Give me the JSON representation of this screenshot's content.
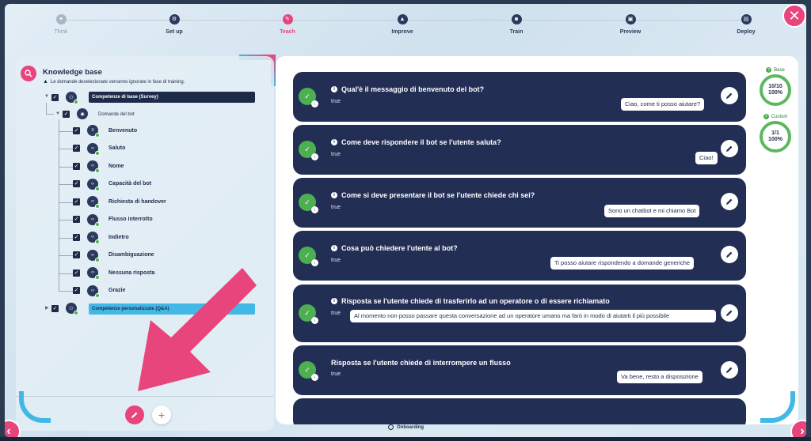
{
  "stepper": {
    "steps": [
      {
        "label": "Think",
        "state": "muted",
        "icon": "lightbulb-icon"
      },
      {
        "label": "Set up",
        "state": "done",
        "icon": "gear-icon"
      },
      {
        "label": "Teach",
        "state": "active",
        "icon": "pencil-icon"
      },
      {
        "label": "Improve",
        "state": "done",
        "icon": "chart-icon"
      },
      {
        "label": "Train",
        "state": "done",
        "icon": "robot-icon"
      },
      {
        "label": "Preview",
        "state": "done",
        "icon": "monitor-icon"
      },
      {
        "label": "Deploy",
        "state": "done",
        "icon": "rocket-icon"
      }
    ]
  },
  "knowledge": {
    "title": "Knowledge base",
    "warning": "Le domande deselezionate verranno ignorate in fase di training.",
    "group_base": "Competenze di base (Survey)",
    "sub_group": "Domande del bot",
    "items": [
      {
        "label": "Benvenuto",
        "icon": "text-icon"
      },
      {
        "label": "Saluto",
        "icon": "code-icon"
      },
      {
        "label": "Nome",
        "icon": "code-icon"
      },
      {
        "label": "Capacità del bot",
        "icon": "code-icon"
      },
      {
        "label": "Richiesta di handover",
        "icon": "code-icon"
      },
      {
        "label": "Flusso interrotto",
        "icon": "code-icon"
      },
      {
        "label": "Indietro",
        "icon": "code-icon"
      },
      {
        "label": "Disambiguazione",
        "icon": "code-icon"
      },
      {
        "label": "Nessuna risposta",
        "icon": "code-icon"
      },
      {
        "label": "Grazie",
        "icon": "code-icon"
      }
    ],
    "group_custom": "Competenze personalizzate (Q&A)"
  },
  "qa": [
    {
      "question": "Qual'è il messaggio di benvenuto del bot?",
      "value": "true",
      "answer": "Ciao, come ti posso aiutare?",
      "info": true
    },
    {
      "question": "Come deve rispondere il bot se l'utente saluta?",
      "value": "true",
      "answer": "Ciao!",
      "info": true
    },
    {
      "question": "Come si deve presentare il bot se l'utente chiede chi sei?",
      "value": "true",
      "answer": "Sono un chatbot e mi chiamo Bot",
      "info": true
    },
    {
      "question": "Cosa può chiedere l'utente al bot?",
      "value": "true",
      "answer": "Ti posso aiutare rispondendo a domande generiche",
      "info": true
    },
    {
      "question": "Risposta se l'utente chiede di trasferirlo ad un operatore o di essere richiamato",
      "value": "true",
      "answer": "Al momento non posso passare questa conversazione ad un operatore umano ma farò in modo di aiutarti il più possibile",
      "info": true
    },
    {
      "question": "Risposta se l'utente chiede di interrompere un flusso",
      "value": "true",
      "answer": "Va bene, resto a disposizione",
      "info": false
    }
  ],
  "stats": {
    "base": {
      "label": "Base",
      "count": "10/10",
      "percent": "100%"
    },
    "custom": {
      "label": "Custom",
      "count": "1/1",
      "percent": "100%"
    }
  },
  "footer": {
    "onboarding": "Onboarding"
  },
  "colors": {
    "accent": "#e8457d",
    "navy": "#232e55",
    "success": "#4caf50",
    "cyan": "#42b8e6"
  }
}
